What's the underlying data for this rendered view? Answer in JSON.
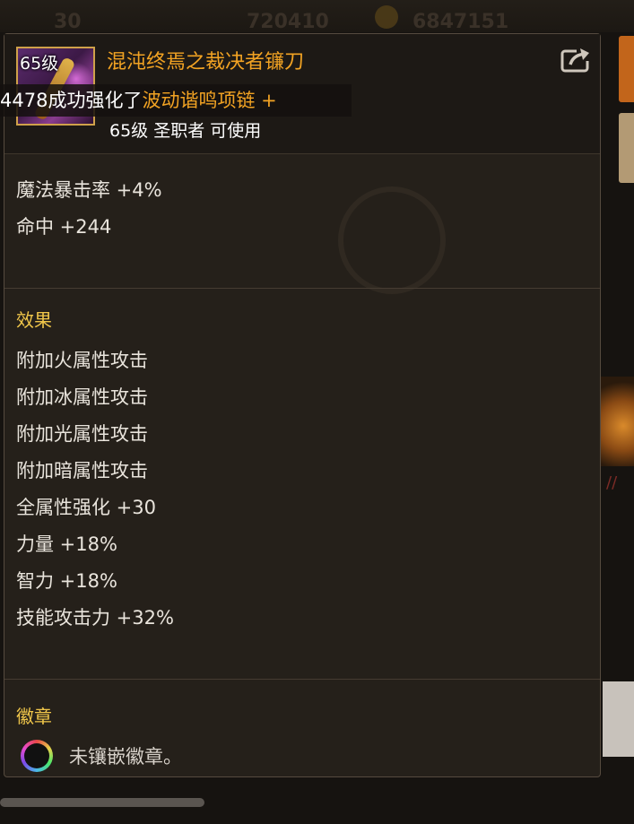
{
  "background": {
    "top_left_value": "30",
    "top_mid_value": "720410",
    "top_right_value": "6847151"
  },
  "tooltip": {
    "icon_level": "65级",
    "item_name": "混沌终焉之裁决者镰刀",
    "notice_prefix": "4478成功强化了",
    "notice_item": "波动谐鸣项链 +",
    "item_requirements": "65级 圣职者 可使用",
    "stats": [
      "魔法暴击率 +4%",
      "命中 +244"
    ],
    "effects_title": "效果",
    "effects": [
      "附加火属性攻击",
      "附加冰属性攻击",
      "附加光属性攻击",
      "附加暗属性攻击",
      "全属性强化 +30",
      "力量 +18%",
      "智力 +18%",
      "技能攻击力 +32%"
    ],
    "emblem_title": "徽章",
    "emblem_text": "未镶嵌徽章。"
  },
  "colors": {
    "item_name": "#f2a323",
    "section_title": "#f0c64a",
    "text": "#e9e4dc",
    "panel_bg": "#26211b"
  }
}
